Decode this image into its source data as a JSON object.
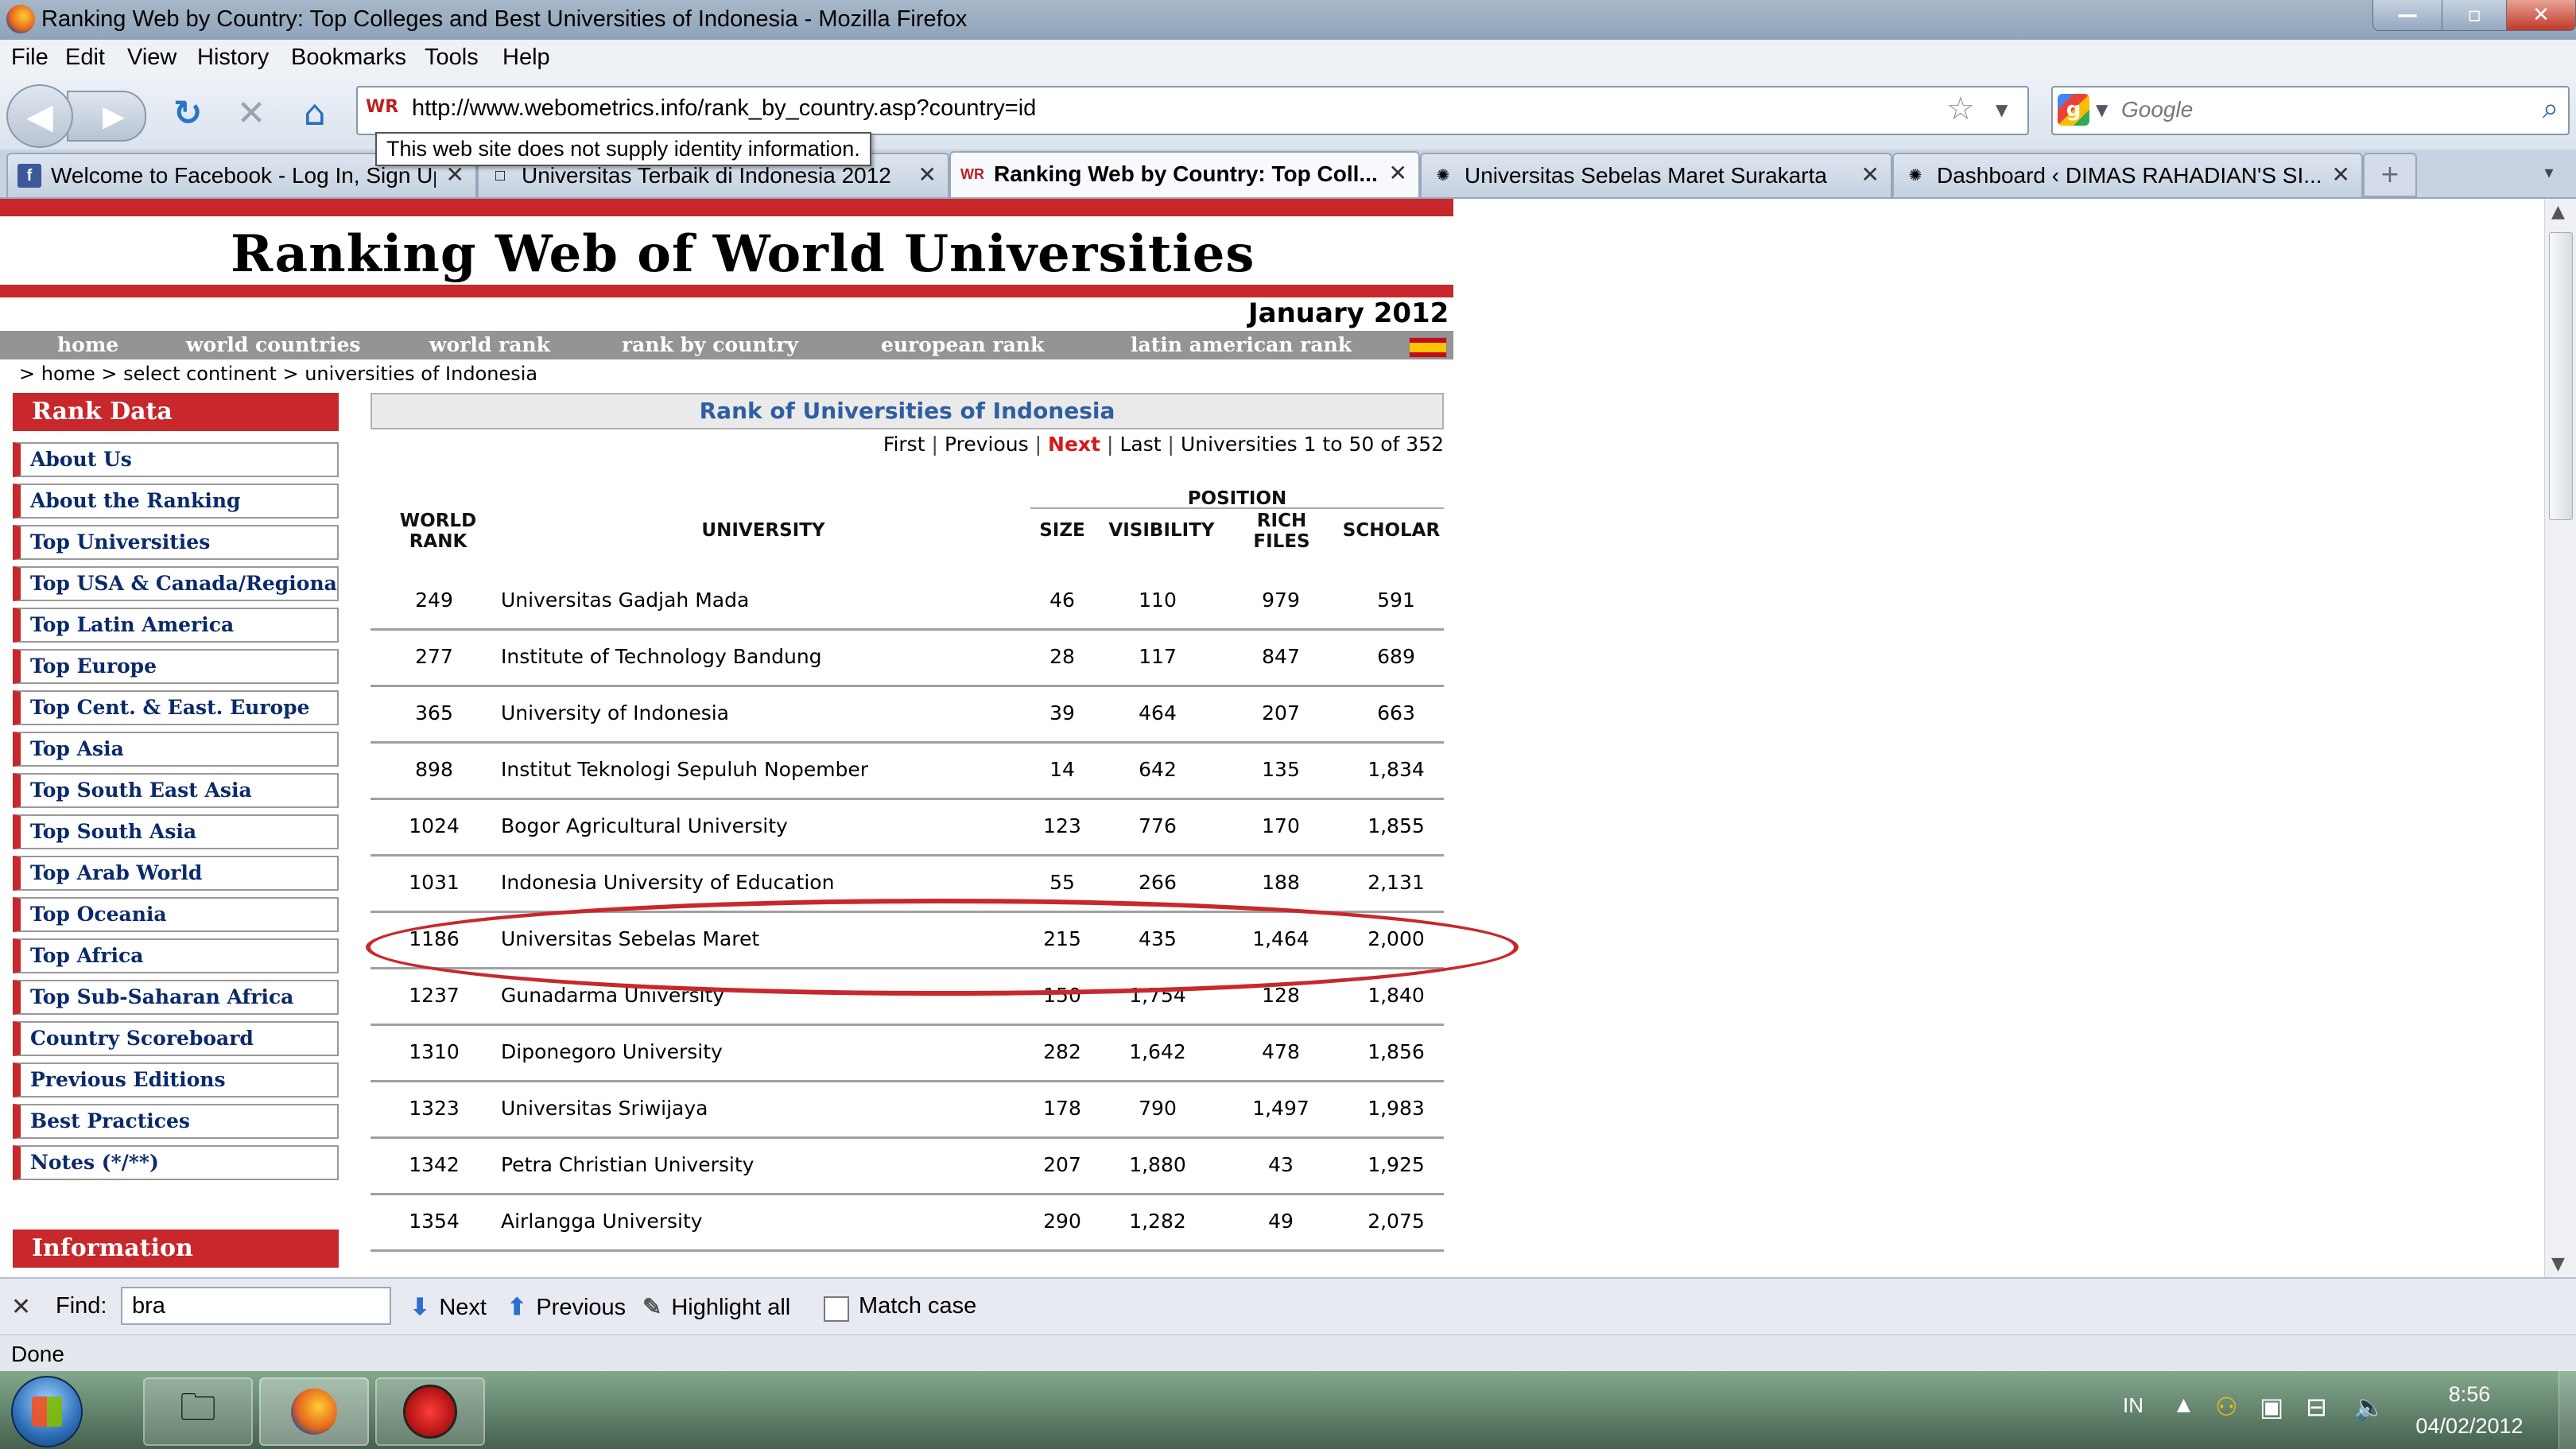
{
  "window": {
    "title": "Ranking Web by Country: Top Colleges and Best Universities of Indonesia - Mozilla Firefox",
    "min": "—",
    "max": "▫",
    "close": "✕"
  },
  "menus": [
    "File",
    "Edit",
    "View",
    "History",
    "Bookmarks",
    "Tools",
    "Help"
  ],
  "nav": {
    "site_badge": "WR",
    "url": "http://www.webometrics.info/rank_by_country.asp?country=id",
    "search_placeholder": "Google",
    "identity_tooltip": "This web site does not supply identity information."
  },
  "tabs": [
    {
      "label": "Welcome to Facebook - Log In, Sign Up or Learn More",
      "icon": "f"
    },
    {
      "label": "Universitas Terbaik di Indonesia 2012",
      "icon": "□"
    },
    {
      "label": "Ranking Web by Country: Top Coll...",
      "icon": "WR"
    },
    {
      "label": "Universitas Sebelas Maret Surakarta",
      "icon": "✺"
    },
    {
      "label": "Dashboard ‹ DIMAS RAHADIAN'S SI...",
      "icon": "✺"
    }
  ],
  "tab_close": "✕",
  "newtab": "+",
  "tablist": "▾",
  "site": {
    "title": "Ranking Web of World Universities",
    "edition": "January 2012",
    "topnav": [
      "home",
      "world countries",
      "world rank",
      "rank by country",
      "european rank",
      "latin american rank"
    ],
    "breadcrumb": ">  home  >  select continent  >  universities of Indonesia"
  },
  "sidebar": {
    "header": "Rank Data",
    "items": [
      "About Us",
      "About the Ranking",
      "Top Universities",
      "Top USA & Canada/Regional",
      "Top Latin America",
      "Top Europe",
      "Top Cent. & East. Europe",
      "Top Asia",
      "Top South East Asia",
      "Top South Asia",
      "Top Arab World",
      "Top Oceania",
      "Top Africa",
      "Top Sub-Saharan Africa",
      "Country Scoreboard",
      "Previous Editions",
      "Best Practices",
      "Notes (*/**)"
    ],
    "info_header": "Information"
  },
  "ranking": {
    "header": "Rank of Universities of Indonesia",
    "pager": {
      "first": "First",
      "previous": "Previous",
      "next": "Next",
      "last": "Last",
      "summary": "Universities 1 to 50 of 352"
    },
    "columns": {
      "world_rank": "WORLD RANK",
      "university": "UNIVERSITY",
      "position": "POSITION",
      "size": "SIZE",
      "visibility": "VISIBILITY",
      "rich_files": "RICH FILES",
      "scholar": "SCHOLAR"
    },
    "rows": [
      {
        "rank": "249",
        "name": "Universitas Gadjah Mada",
        "size": "46",
        "vis": "110",
        "rich": "979",
        "sch": "591"
      },
      {
        "rank": "277",
        "name": "Institute of Technology Bandung",
        "size": "28",
        "vis": "117",
        "rich": "847",
        "sch": "689"
      },
      {
        "rank": "365",
        "name": "University of Indonesia",
        "size": "39",
        "vis": "464",
        "rich": "207",
        "sch": "663"
      },
      {
        "rank": "898",
        "name": "Institut Teknologi Sepuluh Nopember",
        "size": "14",
        "vis": "642",
        "rich": "135",
        "sch": "1,834"
      },
      {
        "rank": "1024",
        "name": "Bogor Agricultural University",
        "size": "123",
        "vis": "776",
        "rich": "170",
        "sch": "1,855"
      },
      {
        "rank": "1031",
        "name": "Indonesia University of Education",
        "size": "55",
        "vis": "266",
        "rich": "188",
        "sch": "2,131"
      },
      {
        "rank": "1186",
        "name": "Universitas Sebelas Maret",
        "size": "215",
        "vis": "435",
        "rich": "1,464",
        "sch": "2,000"
      },
      {
        "rank": "1237",
        "name": "Gunadarma University",
        "size": "150",
        "vis": "1,754",
        "rich": "128",
        "sch": "1,840"
      },
      {
        "rank": "1310",
        "name": "Diponegoro University",
        "size": "282",
        "vis": "1,642",
        "rich": "478",
        "sch": "1,856"
      },
      {
        "rank": "1323",
        "name": "Universitas Sriwijaya",
        "size": "178",
        "vis": "790",
        "rich": "1,497",
        "sch": "1,983"
      },
      {
        "rank": "1342",
        "name": "Petra Christian University",
        "size": "207",
        "vis": "1,880",
        "rich": "43",
        "sch": "1,925"
      },
      {
        "rank": "1354",
        "name": "Airlangga University",
        "size": "290",
        "vis": "1,282",
        "rich": "49",
        "sch": "2,075"
      }
    ]
  },
  "findbar": {
    "close": "✕",
    "label": "Find:",
    "query": "bra",
    "next": "Next",
    "previous": "Previous",
    "highlight": "Highlight all",
    "match_case": "Match case"
  },
  "status": "Done",
  "taskbar": {
    "lang": "IN",
    "time": "8:56",
    "date": "04/02/2012"
  }
}
